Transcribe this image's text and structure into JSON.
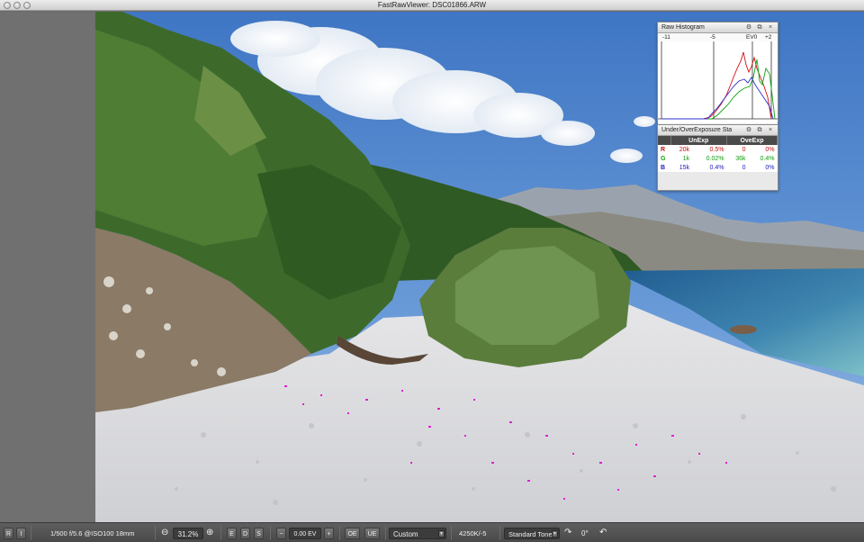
{
  "window": {
    "title": "FastRawViewer: DSC01866.ARW"
  },
  "histogram_panel": {
    "title": "Raw Histogram",
    "scale_labels": [
      "-11",
      "-5",
      "EV0",
      "+2"
    ],
    "settings_icon": "gear-icon",
    "colors": {
      "red": "#d01010",
      "green": "#10a010",
      "blue": "#3030d0"
    }
  },
  "exposure_panel": {
    "title": "Under/OverExposure Sta",
    "columns": [
      "",
      "UnExp",
      "",
      "OveExp",
      ""
    ],
    "rows": [
      {
        "channel": "R",
        "un_count": "20k",
        "un_pct": "0.5%",
        "ov_count": "0",
        "ov_pct": "0%",
        "color": "#c01010"
      },
      {
        "channel": "G",
        "un_count": "1k",
        "un_pct": "0.02%",
        "ov_count": "36k",
        "ov_pct": "0.4%",
        "color": "#10a010"
      },
      {
        "channel": "B",
        "un_count": "15k",
        "un_pct": "0.4%",
        "ov_count": "0",
        "ov_pct": "0%",
        "color": "#2020c0"
      }
    ]
  },
  "statusbar": {
    "btn_r": "R",
    "btn_i": "I",
    "exposure_info": "1/500 f/5.6 @ISO100 18mm",
    "zoom": "31.2%",
    "btn_e": "E",
    "btn_d": "D",
    "btn_s": "S",
    "ev_minus": "−",
    "ev_value": "0.00 EV",
    "ev_plus": "+",
    "btn_oe": "OE",
    "btn_ue": "UE",
    "wb_preset": "Custom",
    "wb_value": "4250K/-5",
    "tone_curve": "Standard Tone",
    "rotation": "0°"
  }
}
